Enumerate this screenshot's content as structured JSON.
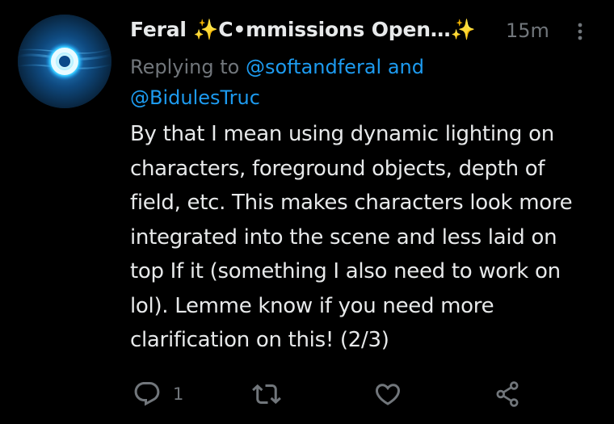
{
  "tweet": {
    "display_name": "Feral ✨C•mmissions Open…✨",
    "timestamp": "15m",
    "reply_prefix": "Replying to",
    "mention_1": "@softandferal",
    "reply_conjunction": "and",
    "mention_2": "@BidulesTruc",
    "body": "By that I mean using dynamic lighting on characters, foreground objects, depth of field, etc. This makes characters look more integrated into the scene and less laid on top If it (something I also need to work on lol). Lemme know if you need more clarification on this! (2/3)",
    "reply_count": "1"
  },
  "icons": {
    "more": "more-vertical-icon",
    "reply": "reply-icon",
    "retweet": "retweet-icon",
    "like": "heart-icon",
    "share": "share-icon"
  },
  "colors": {
    "background": "#000000",
    "text_primary": "#e7e9ea",
    "text_secondary": "#71767b",
    "accent": "#1d9bf0"
  }
}
